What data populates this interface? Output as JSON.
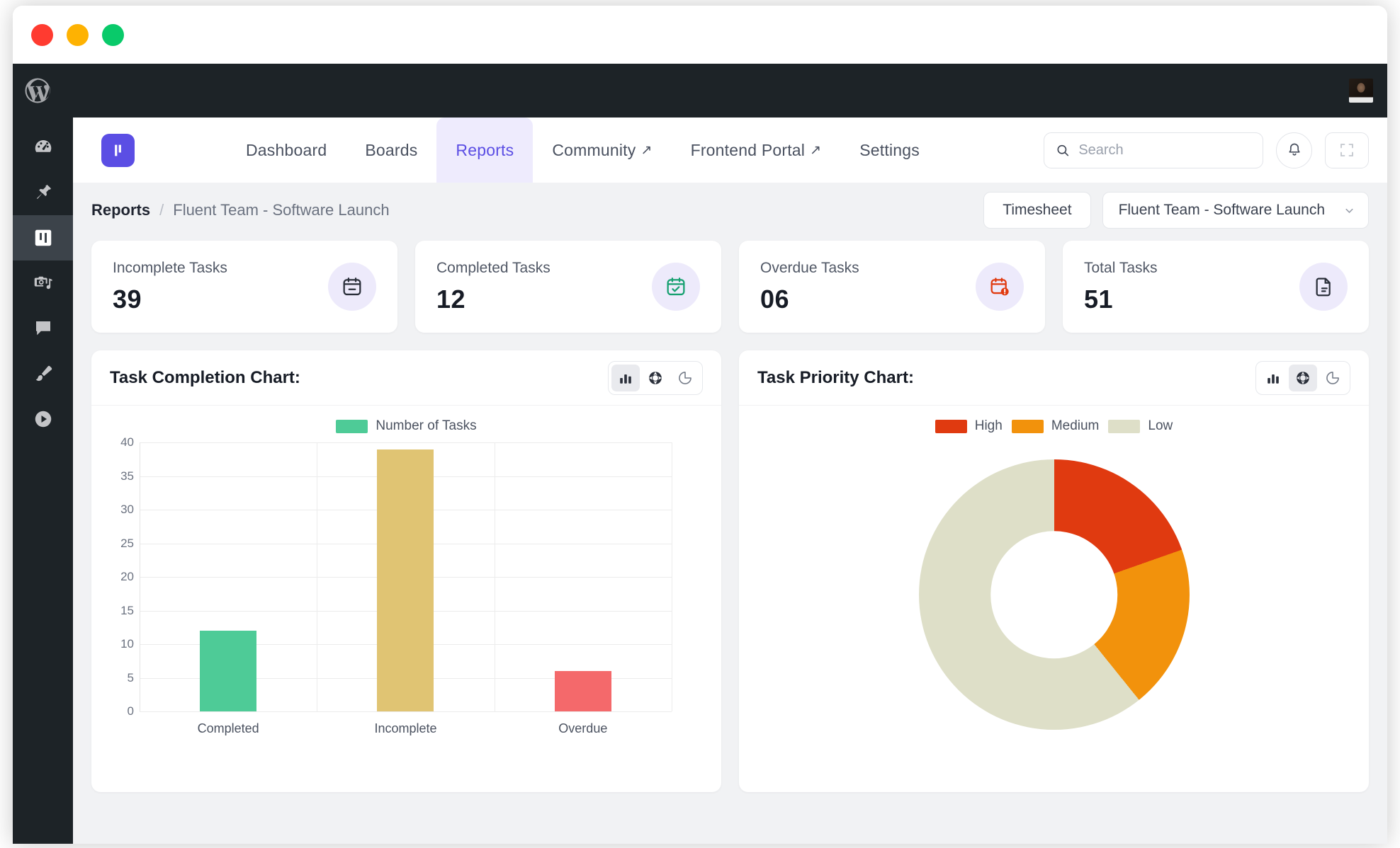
{
  "window": {
    "traffic_lights": [
      "close",
      "minimize",
      "maximize"
    ]
  },
  "wp_admin_bar": {
    "logo_name": "wordpress-logo-icon",
    "avatar_name": "user-avatar"
  },
  "wp_sidebar": {
    "items": [
      {
        "name": "dashboard",
        "icon": "gauge-icon",
        "active": false
      },
      {
        "name": "posts",
        "icon": "pin-icon",
        "active": false
      },
      {
        "name": "boards",
        "icon": "kanban-icon",
        "active": true
      },
      {
        "name": "media",
        "icon": "media-icon",
        "active": false
      },
      {
        "name": "comments",
        "icon": "comment-icon",
        "active": false
      },
      {
        "name": "appearance",
        "icon": "brush-icon",
        "active": false
      },
      {
        "name": "plugins",
        "icon": "play-circle-icon",
        "active": false
      }
    ]
  },
  "appnav": {
    "logo_name": "app-logo-icon",
    "links": [
      {
        "label": "Dashboard",
        "external": false,
        "active": false
      },
      {
        "label": "Boards",
        "external": false,
        "active": false
      },
      {
        "label": "Reports",
        "external": false,
        "active": true
      },
      {
        "label": "Community",
        "external": true,
        "active": false
      },
      {
        "label": "Frontend Portal",
        "external": true,
        "active": false
      },
      {
        "label": "Settings",
        "external": false,
        "active": false
      }
    ],
    "external_arrow": "↗",
    "search": {
      "placeholder": "Search",
      "value": ""
    },
    "notification_icon": "bell-icon",
    "fullscreen_icon": "expand-icon"
  },
  "breadcrumb": {
    "root": "Reports",
    "separator": "/",
    "current": "Fluent Team - Software Launch"
  },
  "header_actions": {
    "timesheet_label": "Timesheet",
    "board_select": {
      "value": "Fluent Team - Software Launch",
      "chevron": "⌄"
    }
  },
  "stats": [
    {
      "label": "Incomplete Tasks",
      "value": "39",
      "icon": "calendar-minus-icon",
      "icon_color": "#2a2f3a"
    },
    {
      "label": "Completed Tasks",
      "value": "12",
      "icon": "calendar-check-icon",
      "icon_color": "#16A070"
    },
    {
      "label": "Overdue Tasks",
      "value": "06",
      "icon": "calendar-alert-icon",
      "icon_color": "#E03A10"
    },
    {
      "label": "Total Tasks",
      "value": "51",
      "icon": "document-icon",
      "icon_color": "#2a2f3a"
    }
  ],
  "panels": {
    "completion": {
      "title": "Task Completion Chart:",
      "toggles": [
        {
          "name": "bar-chart-toggle",
          "icon": "bar-chart-icon",
          "active": true
        },
        {
          "name": "donut-chart-toggle",
          "icon": "donut-chart-icon",
          "active": false
        },
        {
          "name": "pie-chart-toggle",
          "icon": "pie-chart-icon",
          "active": false
        }
      ]
    },
    "priority": {
      "title": "Task Priority Chart:",
      "toggles": [
        {
          "name": "bar-chart-toggle",
          "icon": "bar-chart-icon",
          "active": false
        },
        {
          "name": "donut-chart-toggle",
          "icon": "donut-chart-icon",
          "active": true
        },
        {
          "name": "pie-chart-toggle",
          "icon": "pie-chart-icon",
          "active": false
        }
      ]
    }
  },
  "chart_data": [
    {
      "type": "bar",
      "title": "Task Completion Chart:",
      "categories": [
        "Completed",
        "Incomplete",
        "Overdue"
      ],
      "values": [
        12,
        39,
        6
      ],
      "colors": [
        "#4ECB97",
        "#E0C473",
        "#F4696B"
      ],
      "series": [
        {
          "name": "Number of Tasks",
          "values": [
            12,
            39,
            6
          ]
        }
      ],
      "legend": [
        "Number of Tasks"
      ],
      "legend_color": "#4ECB97",
      "legend_position": "top-center",
      "xlabel": "",
      "ylabel": "",
      "ylim": [
        0,
        40
      ],
      "yticks": [
        0,
        5,
        10,
        15,
        20,
        25,
        30,
        35,
        40
      ],
      "grid": true
    },
    {
      "type": "pie",
      "subtype": "donut",
      "title": "Task Priority Chart:",
      "categories": [
        "High",
        "Medium",
        "Low"
      ],
      "values": [
        10,
        10,
        31
      ],
      "percentages": [
        20,
        20,
        60
      ],
      "colors": [
        "#E03A10",
        "#F2920C",
        "#DEDFC8"
      ],
      "legend": [
        "High",
        "Medium",
        "Low"
      ],
      "legend_position": "top-center",
      "grid": false
    }
  ]
}
